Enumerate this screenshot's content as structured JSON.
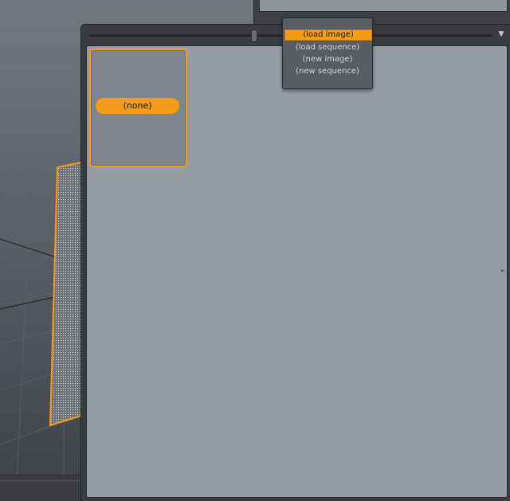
{
  "colors": {
    "accent": "#f39c1a",
    "panel_bg": "#969ca3",
    "window_chrome": "#3a3c3f",
    "menu_bg": "#595c61"
  },
  "image_browser": {
    "menu_icon": "chevron-down-icon",
    "thumbnail": {
      "label": "(none)",
      "selected": true
    }
  },
  "popup_menu": {
    "items": [
      {
        "label": "(load image)",
        "selected": true
      },
      {
        "label": "(load sequence)",
        "selected": false
      },
      {
        "label": "(new image)",
        "selected": false
      },
      {
        "label": "(new sequence)",
        "selected": false
      }
    ]
  }
}
